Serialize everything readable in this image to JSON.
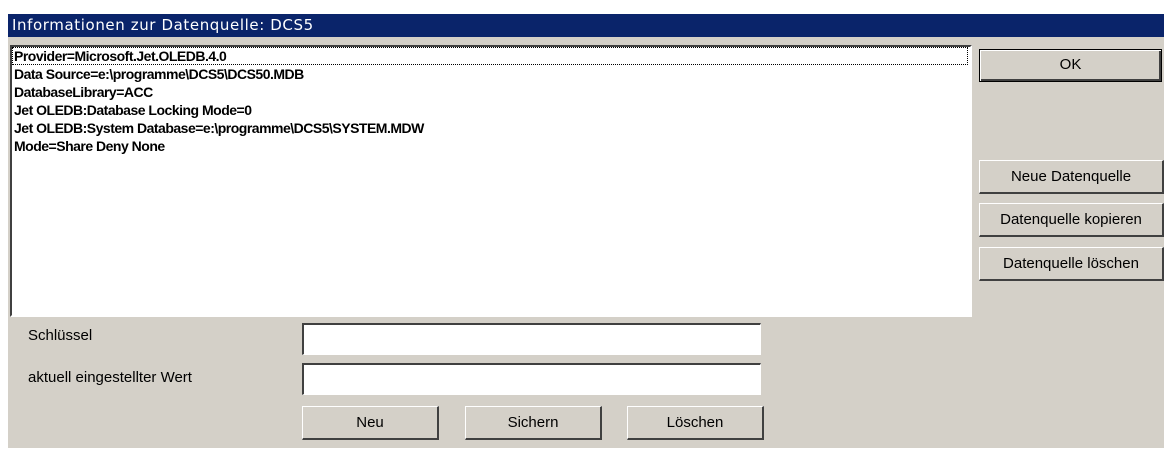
{
  "window": {
    "title": "Informationen zur Datenquelle: DCS5"
  },
  "connection_properties": [
    "Provider=Microsoft.Jet.OLEDB.4.0",
    "Data Source=e:\\programme\\DCS5\\DCS50.MDB",
    "DatabaseLibrary=ACC",
    "Jet OLEDB:Database Locking Mode=0",
    "Jet OLEDB:System Database=e:\\programme\\DCS5\\SYSTEM.MDW",
    "Mode=Share Deny None"
  ],
  "buttons": {
    "ok": "OK",
    "new_source": "Neue Datenquelle",
    "copy_source": "Datenquelle kopieren",
    "delete_source": "Datenquelle löschen",
    "new": "Neu",
    "save": "Sichern",
    "delete": "Löschen"
  },
  "form": {
    "key_label": "Schlüssel",
    "key_value": "",
    "value_label": "aktuell eingestellter Wert",
    "value_value": ""
  }
}
